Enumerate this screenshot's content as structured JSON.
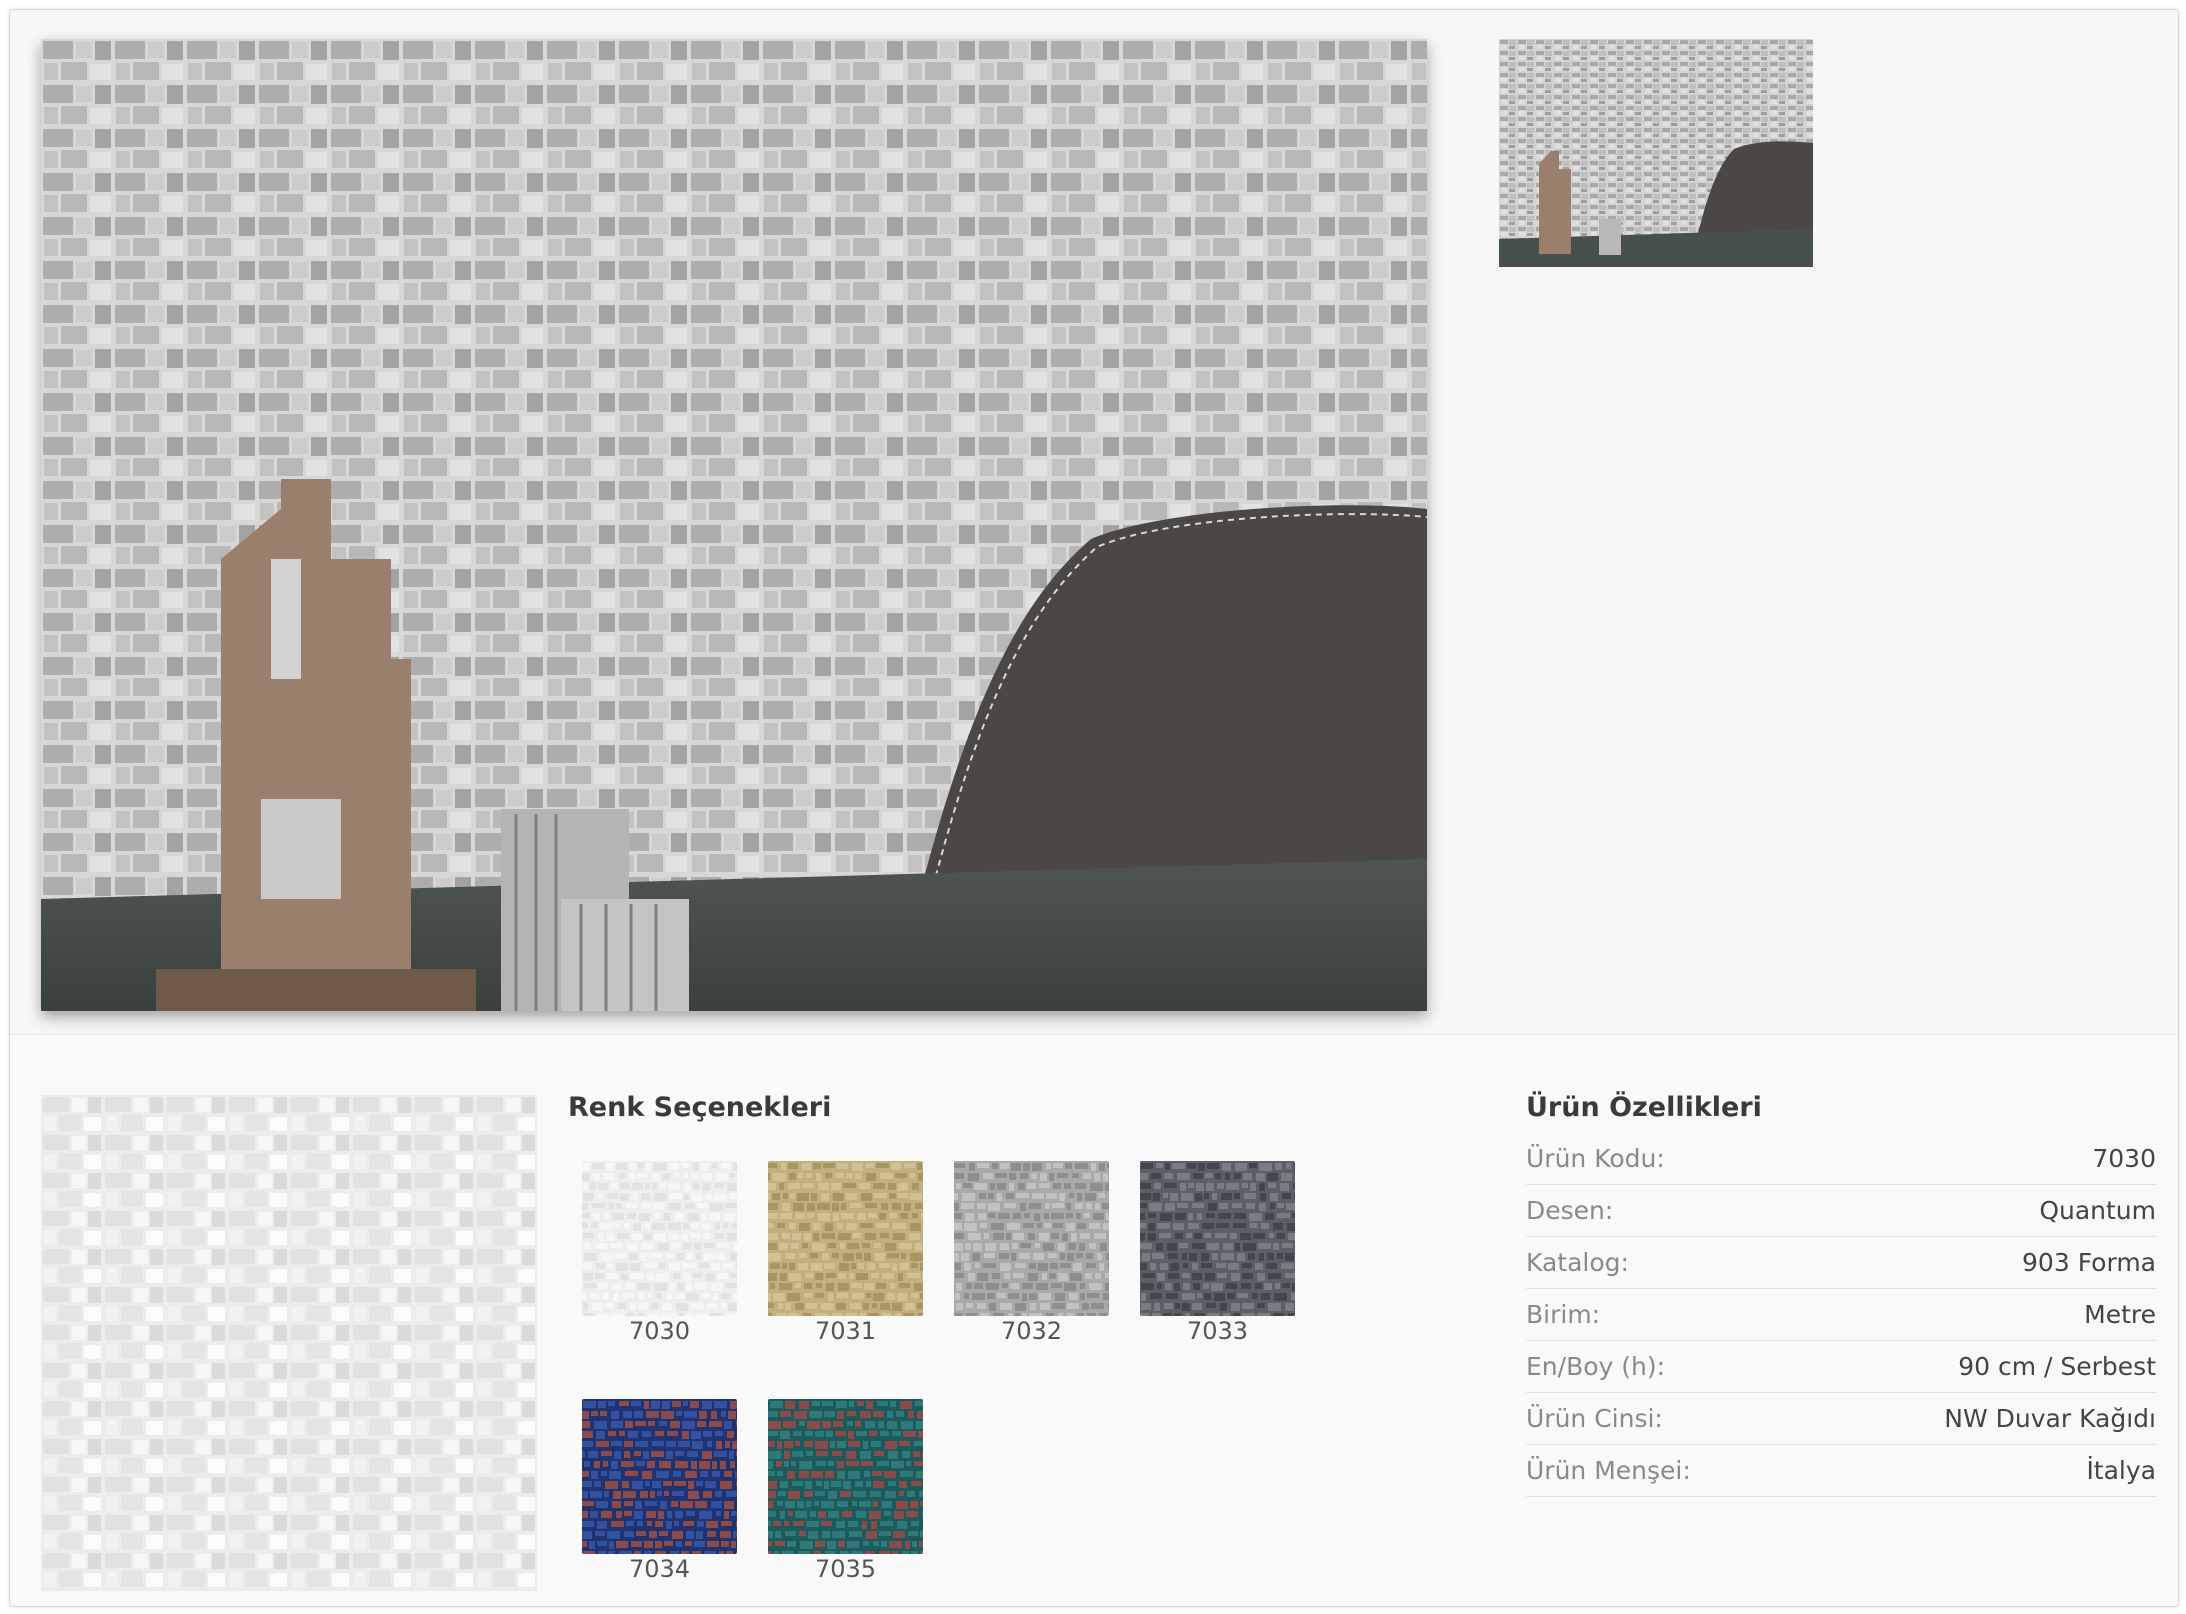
{
  "colors": {
    "background": "#f7f7f7",
    "frame_border": "#d6d6d6",
    "label_gray": "#8a8a8a",
    "value_dark": "#444444"
  },
  "gallery": {
    "main_image_alt": "room scene with mosaic wallpaper",
    "thumbnail_alt": "room scene thumbnail"
  },
  "color_options": {
    "title": "Renk Seçenekleri",
    "swatches": [
      {
        "code": "7030",
        "base": "#eeeeee",
        "tile_a": "#f6f6f6",
        "tile_b": "#e2e2e2"
      },
      {
        "code": "7031",
        "base": "#c2b07c",
        "tile_a": "#d1c196",
        "tile_b": "#a89566"
      },
      {
        "code": "7032",
        "base": "#a9a9a9",
        "tile_a": "#c2c2c2",
        "tile_b": "#8e8e8e"
      },
      {
        "code": "7033",
        "base": "#5d5f66",
        "tile_a": "#7a7c83",
        "tile_b": "#44464d"
      },
      {
        "code": "7034",
        "base": "#1f3272",
        "tile_a": "#3451a0",
        "tile_b": "#8a4b4a"
      },
      {
        "code": "7035",
        "base": "#1d5a5c",
        "tile_a": "#2f7a78",
        "tile_b": "#8a4b4a"
      }
    ]
  },
  "specs": {
    "title": "Ürün Özellikleri",
    "rows": [
      {
        "label": "Ürün Kodu:",
        "value": "7030"
      },
      {
        "label": "Desen:",
        "value": "Quantum"
      },
      {
        "label": "Katalog:",
        "value": "903 Forma"
      },
      {
        "label": "Birim:",
        "value": "Metre"
      },
      {
        "label": "En/Boy (h):",
        "value": "90 cm / Serbest"
      },
      {
        "label": "Ürün Cinsi:",
        "value": "NW Duvar Kağıdı"
      },
      {
        "label": "Ürün Menşei:",
        "value": "İtalya"
      }
    ]
  }
}
